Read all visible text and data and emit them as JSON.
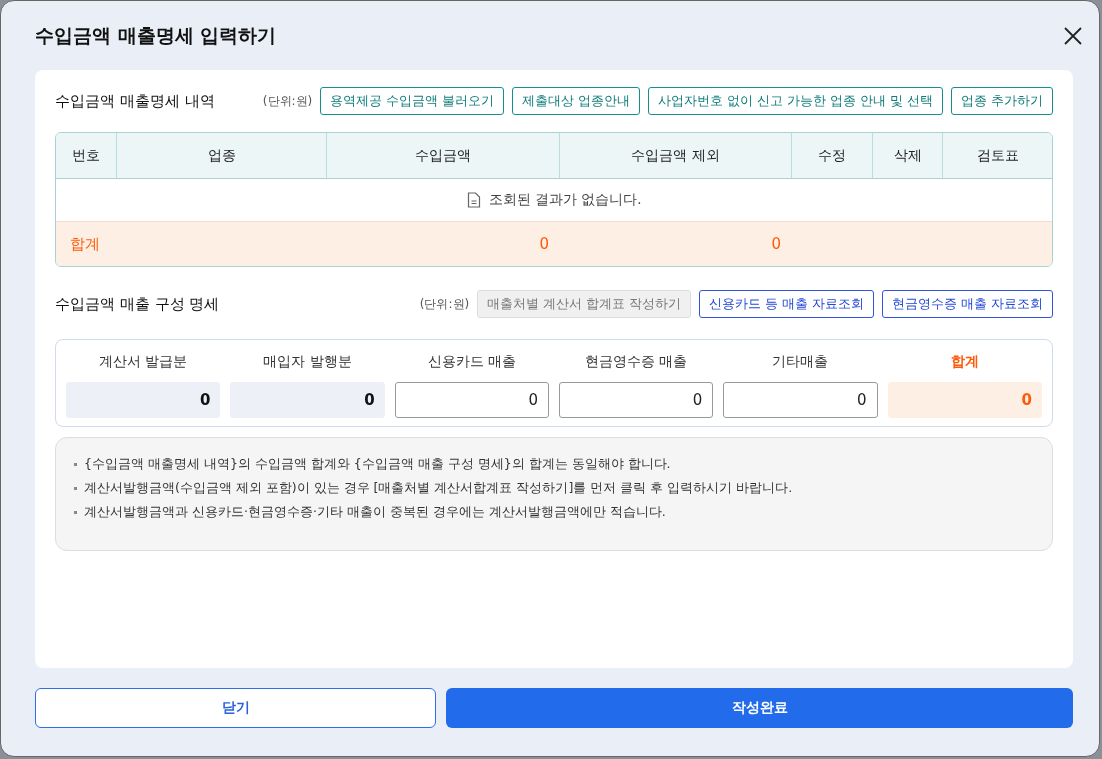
{
  "dialog": {
    "title": "수입금액 매출명세 입력하기"
  },
  "sales_detail": {
    "title": "수입금액 매출명세 내역",
    "unit": "(단위:원)",
    "buttons": [
      {
        "label": "용역제공 수입금액 불러오기",
        "kind": "teal",
        "disabled": false
      },
      {
        "label": "제출대상 업종안내",
        "kind": "teal",
        "disabled": false
      },
      {
        "label": "사업자번호 없이 신고 가능한 업종 안내 및 선택",
        "kind": "teal",
        "disabled": false
      },
      {
        "label": "업종 추가하기",
        "kind": "teal",
        "disabled": false
      }
    ],
    "columns": [
      "번호",
      "업종",
      "수입금액",
      "수입금액 제외",
      "수정",
      "삭제",
      "검토표"
    ],
    "empty_message": "조회된 결과가 없습니다.",
    "total": {
      "label": "합계",
      "income": "0",
      "excluded": "0"
    }
  },
  "composition": {
    "title": "수입금액 매출 구성 명세",
    "unit": "(단위:원)",
    "buttons": [
      {
        "label": "매출처별 계산서 합계표 작성하기",
        "kind": "blue",
        "disabled": true
      },
      {
        "label": "신용카드 등 매출 자료조회",
        "kind": "blue",
        "disabled": false
      },
      {
        "label": "현금영수증 매출 자료조회",
        "kind": "blue",
        "disabled": false
      }
    ],
    "fields": [
      {
        "label": "계산서 발급분",
        "value": "0",
        "kind": "readonly"
      },
      {
        "label": "매입자 발행분",
        "value": "0",
        "kind": "readonly"
      },
      {
        "label": "신용카드 매출",
        "value": "0",
        "kind": "input"
      },
      {
        "label": "현금영수증 매출",
        "value": "0",
        "kind": "input"
      },
      {
        "label": "기타매출",
        "value": "0",
        "kind": "input"
      },
      {
        "label": "합계",
        "value": "0",
        "kind": "total"
      }
    ]
  },
  "notes": [
    "{수입금액 매출명세 내역}의 수입금액 합계와 {수입금액 매출 구성 명세}의 합계는 동일해야 합니다.",
    "계산서발행금액(수입금액 제외 포함)이 있는 경우 [매출처별 계산서합계표 작성하기]를 먼저 클릭 후 입력하시기 바랍니다.",
    "계산서발행금액과 신용카드·현금영수증·기타 매출이 중복된 경우에는 계산서발행금액에만 적습니다."
  ],
  "footer_buttons": [
    {
      "label": "닫기",
      "kind": "secondary"
    },
    {
      "label": "작성완료",
      "kind": "primary"
    }
  ]
}
